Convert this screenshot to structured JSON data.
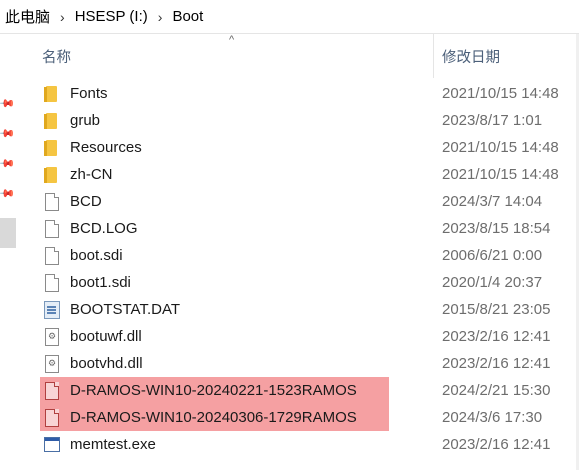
{
  "breadcrumb": {
    "parts": [
      "此电脑",
      "HSESP (I:)",
      "Boot"
    ],
    "separator": "›"
  },
  "columns": {
    "name": "名称",
    "date": "修改日期",
    "sort_caret": "^"
  },
  "files": [
    {
      "name": "Fonts",
      "date": "2021/10/15 14:48",
      "icon": "folder-icon"
    },
    {
      "name": "grub",
      "date": "2023/8/17 1:01",
      "icon": "folder-icon"
    },
    {
      "name": "Resources",
      "date": "2021/10/15 14:48",
      "icon": "folder-icon"
    },
    {
      "name": "zh-CN",
      "date": "2021/10/15 14:48",
      "icon": "folder-icon"
    },
    {
      "name": "BCD",
      "date": "2024/3/7 14:04",
      "icon": "file-icon"
    },
    {
      "name": "BCD.LOG",
      "date": "2023/8/15 18:54",
      "icon": "file-icon"
    },
    {
      "name": "boot.sdi",
      "date": "2006/6/21 0:00",
      "icon": "file-icon"
    },
    {
      "name": "boot1.sdi",
      "date": "2020/1/4 20:37",
      "icon": "file-icon"
    },
    {
      "name": "BOOTSTAT.DAT",
      "date": "2015/8/21 23:05",
      "icon": "dat-file-icon"
    },
    {
      "name": "bootuwf.dll",
      "date": "2023/2/16 12:41",
      "icon": "dll-file-icon"
    },
    {
      "name": "bootvhd.dll",
      "date": "2023/2/16 12:41",
      "icon": "dll-file-icon"
    },
    {
      "name": "D-RAMOS-WIN10-20240221-1523RAMOS",
      "date": "2024/2/21 15:30",
      "icon": "file-icon",
      "highlighted": true
    },
    {
      "name": "D-RAMOS-WIN10-20240306-1729RAMOS",
      "date": "2024/3/6 17:30",
      "icon": "file-icon",
      "highlighted": true
    },
    {
      "name": "memtest.exe",
      "date": "2023/2/16 12:41",
      "icon": "exe-file-icon"
    }
  ],
  "colors": {
    "highlight": "#f5a0a2",
    "header_text": "#4c607a",
    "date_text": "#6d6d6d"
  }
}
